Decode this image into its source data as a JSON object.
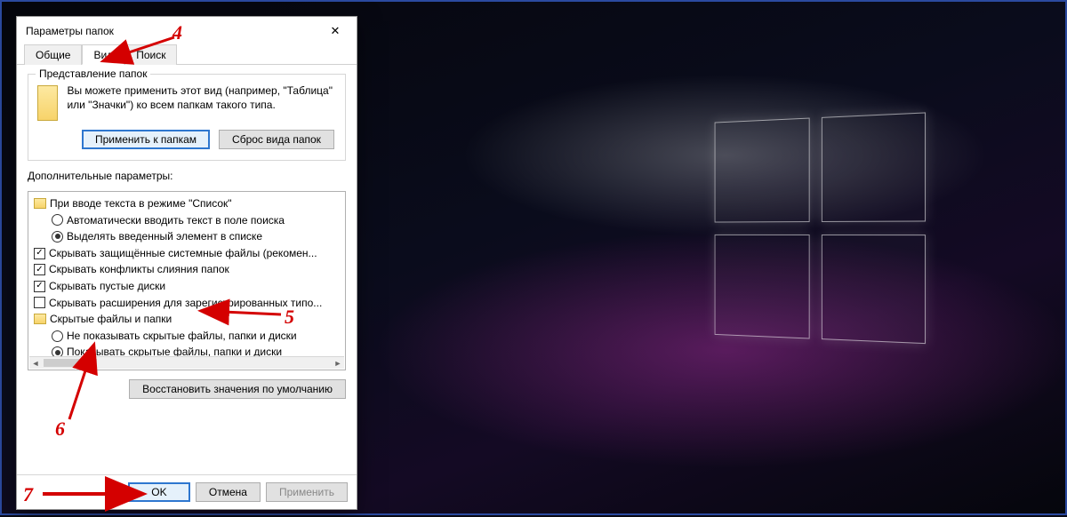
{
  "dialog": {
    "title": "Параметры папок",
    "tabs": {
      "general": "Общие",
      "view": "Вид",
      "search": "Поиск"
    },
    "folder_views": {
      "legend": "Представление папок",
      "desc": "Вы можете применить этот вид (например, \"Таблица\" или \"Значки\") ко всем папкам такого типа.",
      "apply_btn": "Применить к папкам",
      "reset_btn": "Сброс вида папок"
    },
    "advanced_label": "Дополнительные параметры:",
    "tree": {
      "n0": "При вводе текста в режиме \"Список\"",
      "n0a": "Автоматически вводить текст в поле поиска",
      "n0b": "Выделять введенный элемент в списке",
      "n1": "Скрывать защищённые системные файлы (рекомен...",
      "n2": "Скрывать конфликты слияния папок",
      "n3": "Скрывать пустые диски",
      "n4": "Скрывать расширения для зарегистрированных типо...",
      "n5": "Скрытые файлы и папки",
      "n5a": "Не показывать скрытые файлы, папки и диски",
      "n5b": "Показывать скрытые файлы, папки и диски"
    },
    "restore_btn": "Восстановить значения по умолчанию",
    "footer": {
      "ok": "OK",
      "cancel": "Отмена",
      "apply": "Применить"
    }
  },
  "annotations": {
    "a4": "4",
    "a5": "5",
    "a6": "6",
    "a7": "7"
  }
}
